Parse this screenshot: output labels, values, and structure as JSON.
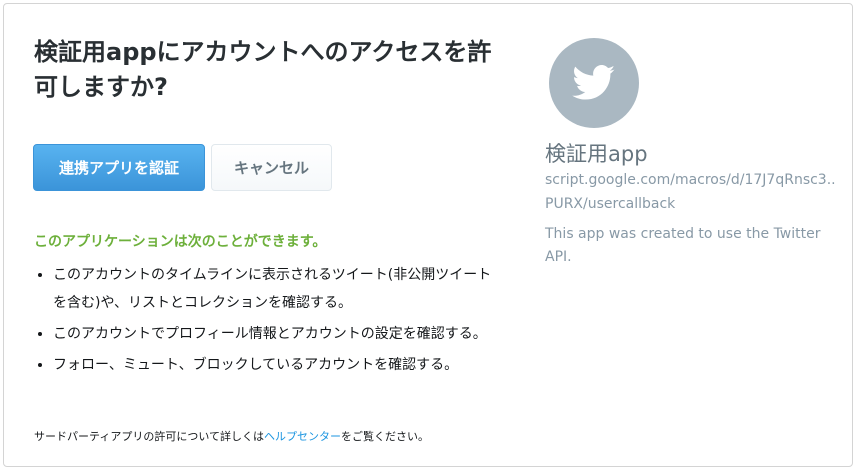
{
  "authorize": {
    "title": "検証用appにアカウントへのアクセスを許可しますか?",
    "authorize_label": "連携アプリを認証",
    "cancel_label": "キャンセル"
  },
  "permissions": {
    "heading": "このアプリケーションは次のことができます。",
    "items": [
      "このアカウントのタイムラインに表示されるツイート(非公開ツイートを含む)や、リストとコレクションを確認する。",
      "このアカウントでプロフィール情報とアカウントの設定を確認する。",
      "フォロー、ミュート、ブロックしているアカウントを確認する。"
    ]
  },
  "footer": {
    "prefix": "サードパーティアプリの許可について詳しくは",
    "link_label": "ヘルプセンター",
    "suffix": "をご覧ください。"
  },
  "app": {
    "avatar_icon": "twitter-bird-icon",
    "name": "検証用app",
    "url_line1": "script.google.com/macros/d/17J7qRnsc3...",
    "url_line2": "PURX/usercallback",
    "description": "This app was created to use the Twitter API."
  },
  "colors": {
    "accent": "#3b94d9",
    "permission_heading": "#6db03b",
    "link": "#1b95e0",
    "avatar_bg": "#aab8c2"
  }
}
